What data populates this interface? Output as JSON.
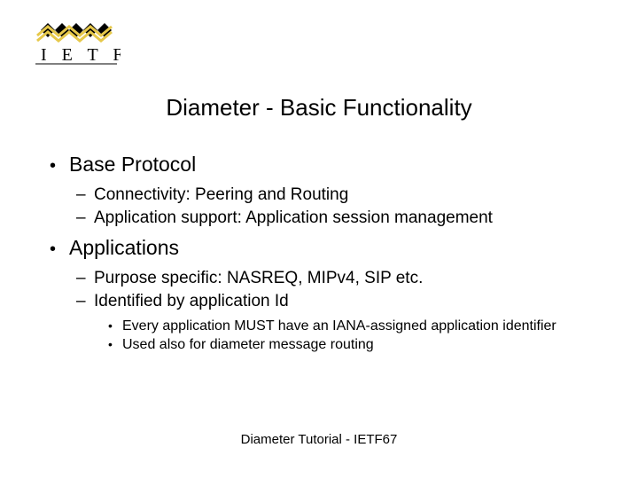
{
  "logo": {
    "text": "I E T F"
  },
  "title": "Diameter - Basic Functionality",
  "bullets": {
    "b1": "Base Protocol",
    "b1_1": "Connectivity: Peering and Routing",
    "b1_2": "Application support: Application session management",
    "b2": "Applications",
    "b2_1": "Purpose specific: NASREQ, MIPv4, SIP etc.",
    "b2_2": "Identified by application Id",
    "b2_2_1": "Every application MUST have an IANA-assigned application identifier",
    "b2_2_2": "Used also for diameter message routing"
  },
  "footer": "Diameter Tutorial - IETF67"
}
